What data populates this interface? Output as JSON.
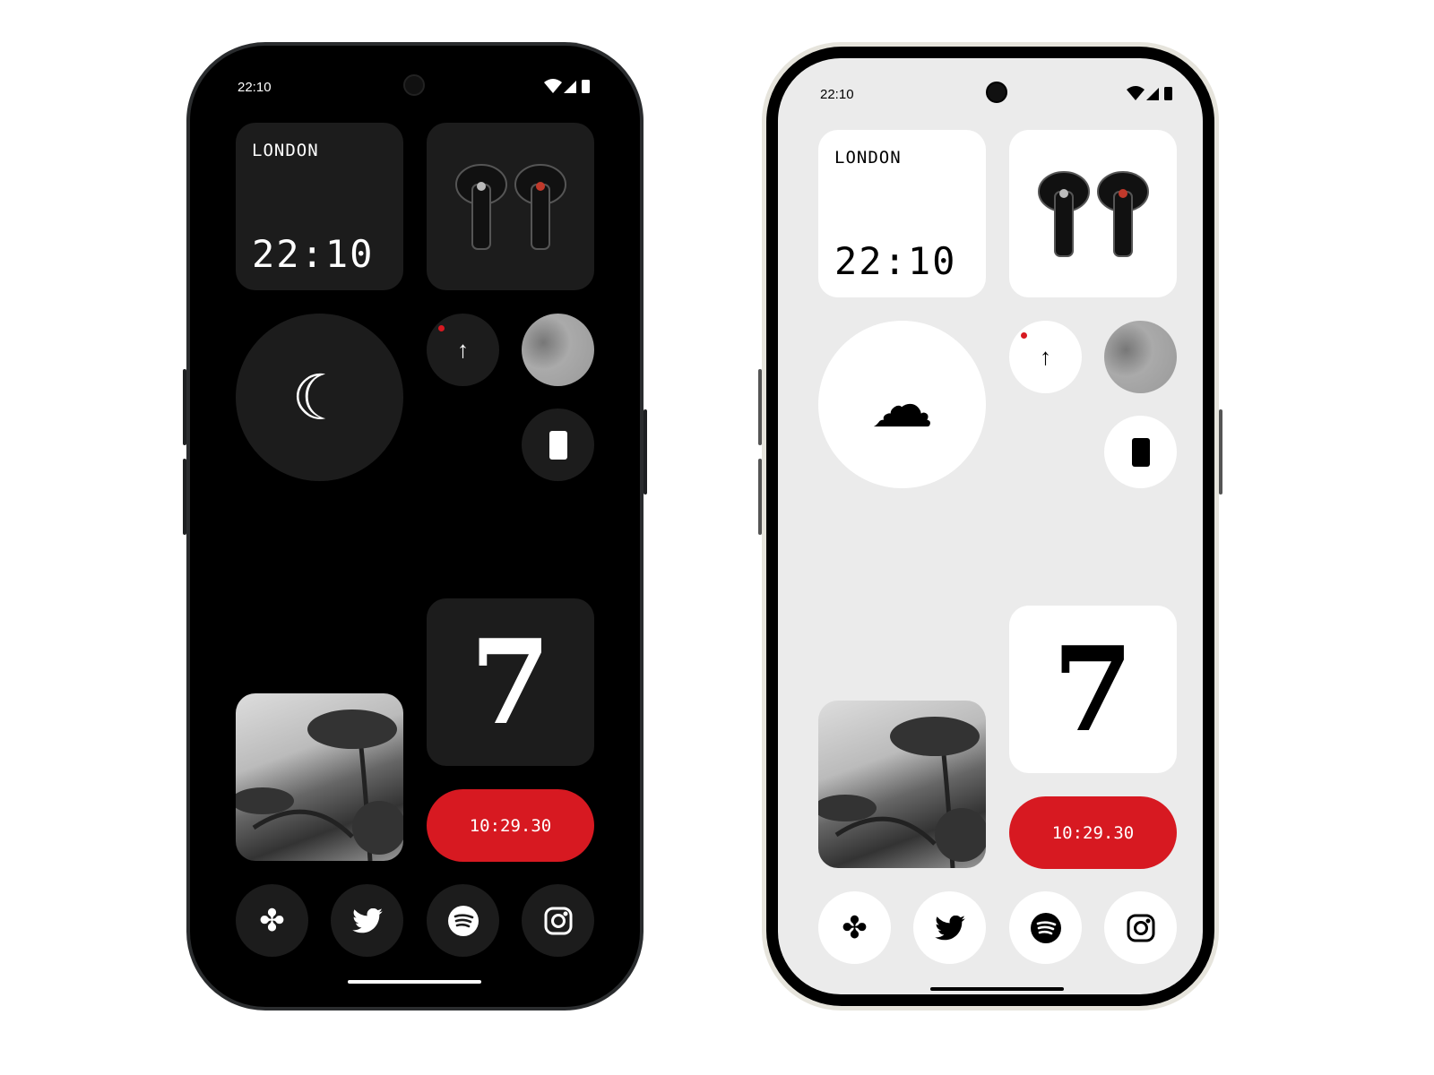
{
  "phones": [
    {
      "theme": "dark",
      "status_time": "22:10",
      "clock_widget": {
        "city": "LONDON",
        "time": "22:10"
      },
      "date_widget": {
        "day": "7"
      },
      "timer_widget": {
        "time": "10:29.30"
      },
      "dock": [
        {
          "icon": "pinwheel-icon"
        },
        {
          "icon": "twitter-icon"
        },
        {
          "icon": "spotify-icon"
        },
        {
          "icon": "instagram-icon"
        }
      ]
    },
    {
      "theme": "light",
      "status_time": "22:10",
      "clock_widget": {
        "city": "LONDON",
        "time": "22:10"
      },
      "date_widget": {
        "day": "7"
      },
      "timer_widget": {
        "time": "10:29.30"
      },
      "dock": [
        {
          "icon": "pinwheel-icon"
        },
        {
          "icon": "twitter-icon"
        },
        {
          "icon": "spotify-icon"
        },
        {
          "icon": "instagram-icon"
        }
      ]
    }
  ],
  "colors": {
    "accent_red": "#d71921",
    "dark_card": "#1c1c1c",
    "light_bg": "#ebebeb"
  }
}
